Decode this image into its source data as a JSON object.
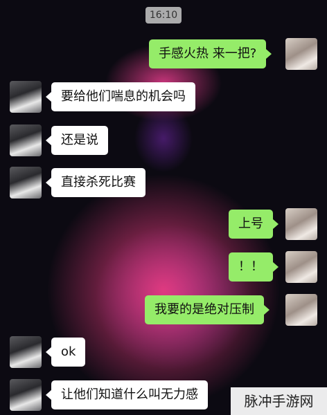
{
  "timestamp": "16:10",
  "messages": [
    {
      "side": "out",
      "text": "手感火热 来一把?"
    },
    {
      "side": "in",
      "text": "要给他们喘息的机会吗"
    },
    {
      "side": "in",
      "text": "还是说"
    },
    {
      "side": "in",
      "text": "直接杀死比赛"
    },
    {
      "side": "out",
      "text": "上号"
    },
    {
      "side": "out",
      "text": "！！"
    },
    {
      "side": "out",
      "text": "我要的是绝对压制"
    },
    {
      "side": "in",
      "text": "ok"
    },
    {
      "side": "in",
      "text": "让他们知道什么叫无力感"
    }
  ],
  "watermark": "脉冲手游网",
  "colors": {
    "outgoing_bubble": "#95ec69",
    "incoming_bubble": "#ffffff",
    "timestamp_bg": "#c8c8c8"
  }
}
